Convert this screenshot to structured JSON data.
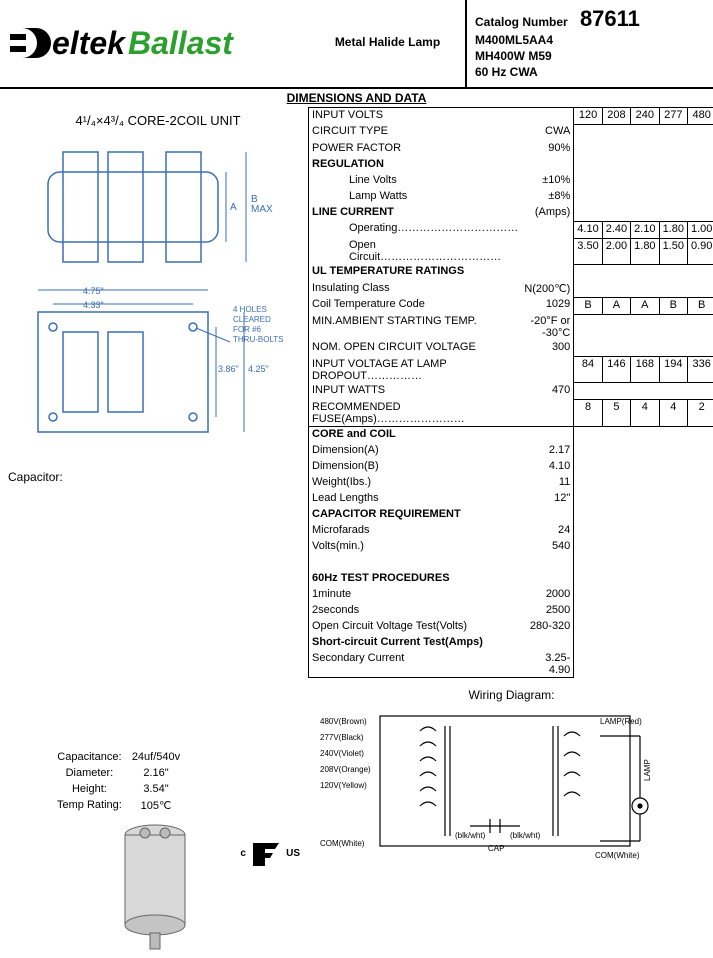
{
  "header": {
    "logo_eltek": "eltek",
    "logo_ballast": "Ballast",
    "lamp_type": "Metal Halide Lamp",
    "catalog_label": "Catalog Number",
    "catalog_number": "87611",
    "line1": "M400ML5AA4",
    "line2": "MH400W  M59",
    "line3": "60 Hz CWA"
  },
  "section_title": "DIMENSIONS AND DATA",
  "core_unit": "4¹/₄×4³/₄ CORE-2COIL UNIT",
  "dim_labels": {
    "a": "A",
    "bmax": "B\nMAX",
    "w475": "4.75\"",
    "w433": "4.33\"",
    "h386": "3.86\"",
    "h425": "4.25\"",
    "holes": "4 HOLES\nCLEARED\nFOR #6\nTHRU-BOLTS"
  },
  "capacitor_label": "Capacitor:",
  "cap": {
    "cap_l": "Capacitance:",
    "cap_v": "24uf/540v",
    "dia_l": "Diameter:",
    "dia_v": "2.16\"",
    "h_l": "Height:",
    "h_v": "3.54\"",
    "t_l": "Temp Rating:",
    "t_v": "105℃"
  },
  "volt_cols": [
    "120",
    "208",
    "240",
    "277",
    "480"
  ],
  "rows": {
    "input_volts": "INPUT VOLTS",
    "circuit_type_l": "CIRCUIT TYPE",
    "circuit_type_v": "CWA",
    "pf_l": "POWER FACTOR",
    "pf_v": "90%",
    "regulation": "REGULATION",
    "line_volts_l": "Line Volts",
    "line_volts_v": "±10%",
    "lamp_watts_l": "Lamp Watts",
    "lamp_watts_v": "±8%",
    "line_current_l": "LINE CURRENT",
    "line_current_v": "(Amps)",
    "operating_l": "Operating……………………………",
    "operating": [
      "4.10",
      "2.40",
      "2.10",
      "1.80",
      "1.00"
    ],
    "open_circ_l": "Open Circuit……………………………",
    "open_circ": [
      "3.50",
      "2.00",
      "1.80",
      "1.50",
      "0.90"
    ],
    "ul": "UL TEMPERATURE RATINGS",
    "ins_l": "Insulating Class",
    "ins_v": "N(200℃)",
    "coil_l": "Coil Temperature Code",
    "coil_v": "1029",
    "coil": [
      "B",
      "A",
      "A",
      "B",
      "B"
    ],
    "min_amb_l": "MIN.AMBIENT STARTING TEMP.",
    "min_amb_v": "-20°F or -30°C",
    "nom_oc_l": "NOM. OPEN CIRCUIT VOLTAGE",
    "nom_oc_v": "300",
    "iv_drop_l": "INPUT VOLTAGE AT LAMP DROPOUT……………",
    "iv_drop": [
      "84",
      "146",
      "168",
      "194",
      "336"
    ],
    "iw_l": "INPUT WATTS",
    "iw_v": "470",
    "fuse_l": "RECOMMENDED FUSE(Amps)……………………",
    "fuse": [
      "8",
      "5",
      "4",
      "4",
      "2"
    ],
    "core": "CORE and COIL",
    "da_l": "Dimension(A)",
    "da_v": "2.17",
    "db_l": "Dimension(B)",
    "db_v": "4.10",
    "wt_l": "Weight(Ibs.)",
    "wt_v": "11",
    "ll_l": "Lead Lengths",
    "ll_v": "12\"",
    "capreq": "CAPACITOR REQUIREMENT",
    "mf_l": "Microfarads",
    "mf_v": "24",
    "vm_l": "Volts(min.)",
    "vm_v": "540",
    "test": "60Hz TEST PROCEDURES",
    "t1_l": "1minute",
    "t1_v": "2000",
    "t2_l": "2seconds",
    "t2_v": "2500",
    "ocv_l": "Open Circuit Voltage Test(Volts)",
    "ocv_v": "280-320",
    "sct": "Short-circuit Current Test(Amps)",
    "sc_l": "Secondary Current",
    "sc_v": "3.25-4.90"
  },
  "wiring_title": "Wiring Diagram:",
  "wiring": {
    "v480": "480V(Brown)",
    "v277": "277V(Black)",
    "v240": "240V(Violet)",
    "v208": "208V(Orange)",
    "v120": "120V(Yellow)",
    "com": "COM(White)",
    "blk": "(blk/wht)",
    "cap": "CAP",
    "lampred": "LAMP(Red)",
    "lamp": "LAMP",
    "comw": "COM(White)"
  },
  "ul_mark": {
    "c": "c",
    "us": "US"
  }
}
